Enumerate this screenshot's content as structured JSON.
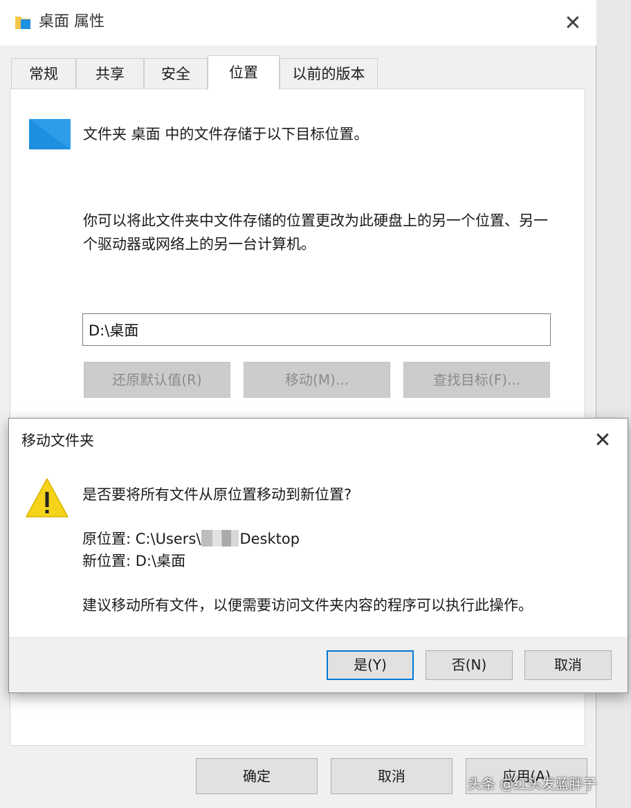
{
  "window": {
    "title": "桌面 属性",
    "close_icon": "✕"
  },
  "tabs": [
    {
      "label": "常规",
      "active": false
    },
    {
      "label": "共享",
      "active": false
    },
    {
      "label": "安全",
      "active": false
    },
    {
      "label": "位置",
      "active": true
    },
    {
      "label": "以前的版本",
      "active": false
    }
  ],
  "location_tab": {
    "heading": "文件夹 桌面 中的文件存储于以下目标位置。",
    "description": "你可以将此文件夹中文件存储的位置更改为此硬盘上的另一个位置、另一个驱动器或网络上的另一台计算机。",
    "path_value": "D:\\桌面",
    "restore_default_label": "还原默认值(R)",
    "move_label": "移动(M)...",
    "find_target_label": "查找目标(F)..."
  },
  "footer": {
    "ok_label": "确定",
    "cancel_label": "取消",
    "apply_label": "应用(A)"
  },
  "move_dialog": {
    "title": "移动文件夹",
    "close_icon": "✕",
    "question": "是否要将所有文件从原位置移动到新位置?",
    "original_label": "原位置:",
    "original_path_prefix": "C:\\Users\\",
    "original_path_suffix": "Desktop",
    "new_label": "新位置:",
    "new_path": "D:\\桌面",
    "advice": "建议移动所有文件，以便需要访问文件夹内容的程序可以执行此操作。",
    "yes_label": "是(Y)",
    "no_label": "否(N)",
    "cancel_label": "取消"
  },
  "watermark": "头条 @红头发蓝胖子",
  "colors": {
    "accent": "#0078d7",
    "folder_blue": "#1e90e0",
    "warning_yellow": "#f5d31a"
  }
}
